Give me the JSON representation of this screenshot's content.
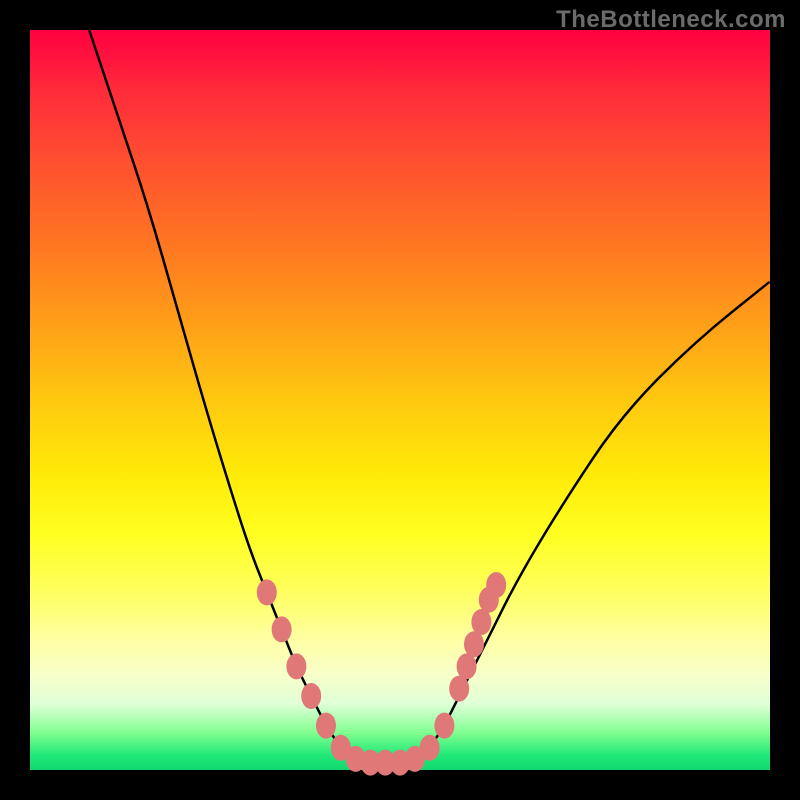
{
  "watermark": "TheBottleneck.com",
  "chart_data": {
    "type": "line",
    "title": "",
    "xlabel": "",
    "ylabel": "",
    "xlim": [
      0,
      100
    ],
    "ylim": [
      0,
      100
    ],
    "background": "rainbow-gradient (red top to green bottom) indicating bottleneck severity; curve minimum = optimal pairing",
    "series": [
      {
        "name": "bottleneck-curve",
        "x": [
          8,
          12,
          16,
          20,
          24,
          28,
          30,
          32,
          34,
          36,
          38,
          40,
          42,
          44,
          46,
          48,
          50,
          52,
          54,
          56,
          58,
          62,
          66,
          72,
          80,
          90,
          100
        ],
        "y": [
          100,
          88,
          76,
          62,
          48,
          35,
          29,
          24,
          19,
          14,
          10,
          6,
          3,
          1.5,
          1,
          1,
          1,
          1.5,
          3,
          6,
          10,
          18,
          26,
          36,
          48,
          58,
          66
        ]
      }
    ],
    "markers": [
      {
        "x": 32,
        "y": 24
      },
      {
        "x": 34,
        "y": 19
      },
      {
        "x": 36,
        "y": 14
      },
      {
        "x": 38,
        "y": 10
      },
      {
        "x": 40,
        "y": 6
      },
      {
        "x": 42,
        "y": 3
      },
      {
        "x": 44,
        "y": 1.5
      },
      {
        "x": 46,
        "y": 1
      },
      {
        "x": 48,
        "y": 1
      },
      {
        "x": 50,
        "y": 1
      },
      {
        "x": 52,
        "y": 1.5
      },
      {
        "x": 54,
        "y": 3
      },
      {
        "x": 56,
        "y": 6
      },
      {
        "x": 58,
        "y": 11
      },
      {
        "x": 59,
        "y": 14
      },
      {
        "x": 60,
        "y": 17
      },
      {
        "x": 61,
        "y": 20
      },
      {
        "x": 62,
        "y": 23
      },
      {
        "x": 63,
        "y": 25
      }
    ]
  }
}
